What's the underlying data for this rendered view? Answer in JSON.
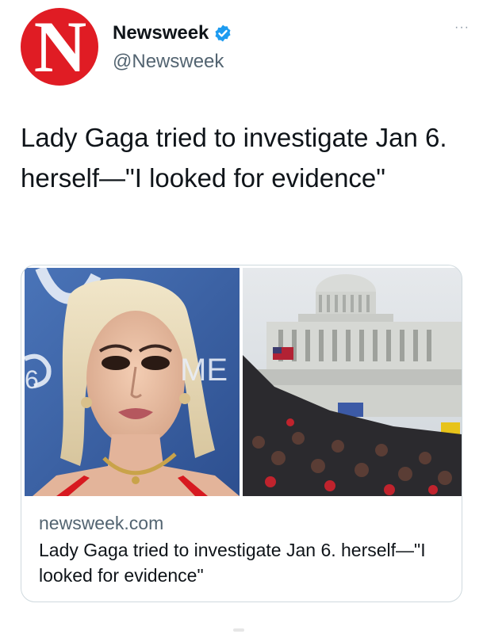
{
  "account": {
    "name": "Newsweek",
    "handle": "@Newsweek",
    "avatar_letter": "N",
    "brand_color": "#e01c24",
    "verified": true,
    "verified_color": "#1d9bf0",
    "more_label": "···"
  },
  "tweet": {
    "text": "Lady Gaga tried to investigate Jan 6. herself—\"I looked for evidence\""
  },
  "card": {
    "domain": "newsweek.com",
    "title": "Lady Gaga tried to investigate Jan 6. herself—\"I looked for evidence\"",
    "left_image_text": "6 ME"
  }
}
